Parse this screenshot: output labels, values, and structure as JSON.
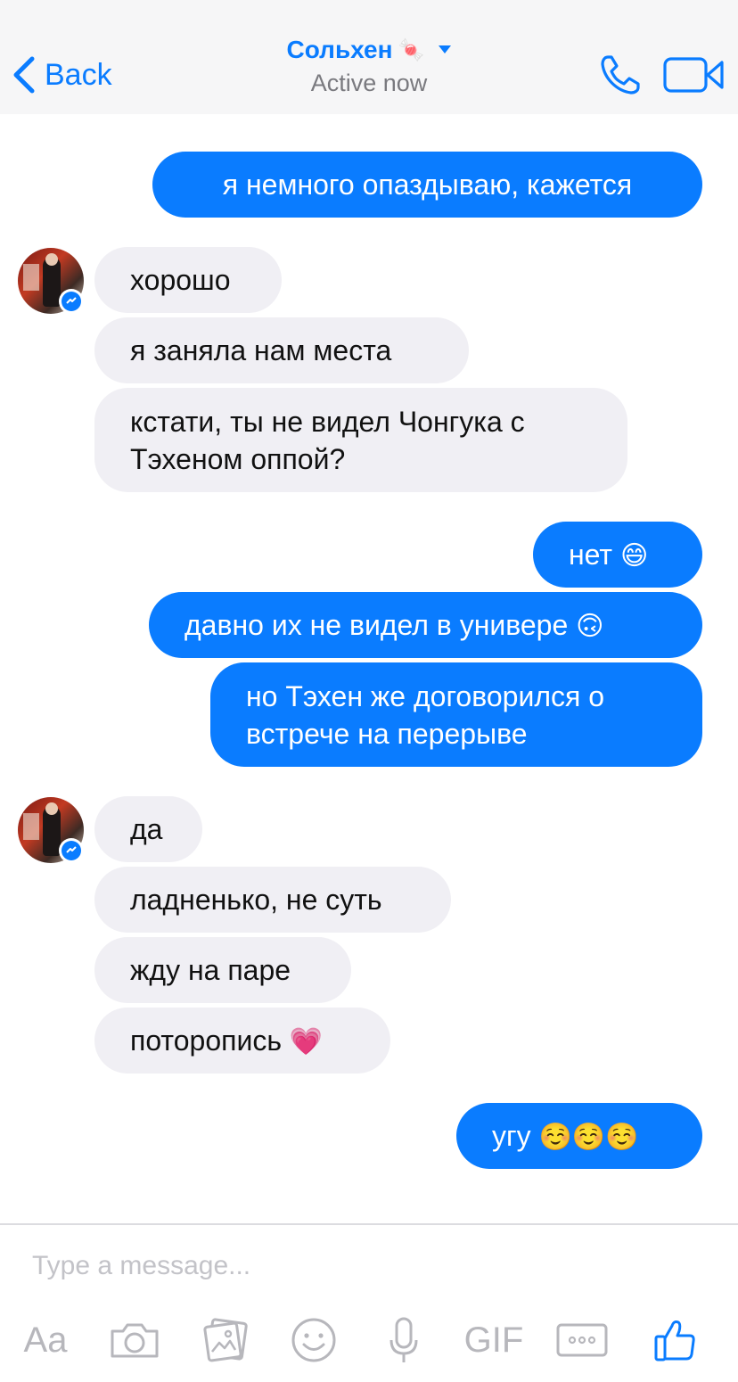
{
  "header": {
    "back_label": "Back",
    "contact_name": "Сольхен",
    "contact_emoji": "🍬",
    "status": "Active now",
    "icons": [
      "chevron-left-icon",
      "dropdown-caret-icon",
      "phone-icon",
      "video-camera-icon"
    ]
  },
  "messages": [
    {
      "dir": "out",
      "text": "я немного опаздываю, кажется"
    },
    {
      "dir": "in",
      "text": "хорошо"
    },
    {
      "dir": "in",
      "text": "я заняла нам места"
    },
    {
      "dir": "in",
      "line1": "кстати, ты не видел Чонгука с",
      "line2": "Тэхеном оппой?"
    },
    {
      "dir": "out",
      "text": "нет",
      "emoji": "😄"
    },
    {
      "dir": "out",
      "text": "давно их не видел в универе",
      "emoji": "🙃"
    },
    {
      "dir": "out",
      "line1": "но Тэхен же договорился о",
      "line2": "встрече на перерыве"
    },
    {
      "dir": "in",
      "text": "да"
    },
    {
      "dir": "in",
      "text": "ладненько, не суть"
    },
    {
      "dir": "in",
      "text": "жду на паре"
    },
    {
      "dir": "in",
      "text": "поторопись",
      "emoji": "💗"
    },
    {
      "dir": "out",
      "text": "угу",
      "emoji": "☺️☺️☺️"
    }
  ],
  "composer": {
    "placeholder": "Type a message...",
    "text_format_label": "Aa",
    "gif_label": "GIF",
    "icons": [
      "camera-icon",
      "photo-gallery-icon",
      "smiley-icon",
      "microphone-icon",
      "more-icon",
      "thumbs-up-icon"
    ]
  },
  "colors": {
    "accent": "#0a7cff",
    "incoming_bubble": "#f0eff4",
    "header_bg": "#f6f6f7",
    "muted": "#b7b7bc"
  }
}
